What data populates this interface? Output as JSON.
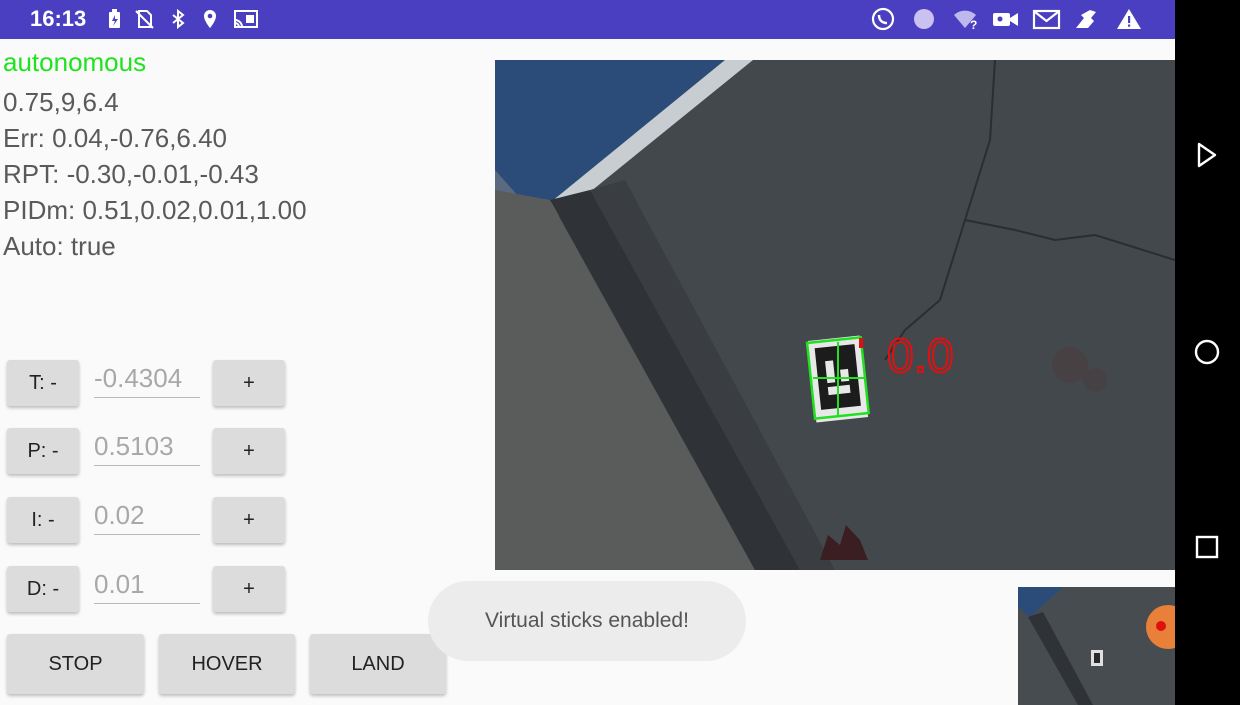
{
  "status_bar": {
    "time": "16:13",
    "left_icons": [
      "battery-icon",
      "no-sim-icon",
      "bluetooth-icon",
      "location-icon",
      "cast-icon"
    ],
    "right_icons": [
      "whatsapp-icon",
      "circle-app-icon",
      "wifi-question-icon",
      "video-camera-icon",
      "gmail-icon",
      "drone-app-icon",
      "warning-icon"
    ]
  },
  "telemetry": {
    "mode": "autonomous",
    "mode_color": "#1ee31e",
    "line1": "0.75,9,6.4",
    "err": "Err: 0.04,-0.76,6.40",
    "rpt": "RPT: -0.30,-0.01,-0.43",
    "pidm": "PIDm: 0.51,0.02,0.01,1.00",
    "auto": "Auto: true"
  },
  "pid_controls": [
    {
      "minus_label": "T: -",
      "value": "-0.4304",
      "plus_label": "+"
    },
    {
      "minus_label": "P: -",
      "value": "0.5103",
      "plus_label": "+"
    },
    {
      "minus_label": "I: -",
      "value": "0.02",
      "plus_label": "+"
    },
    {
      "minus_label": "D: -",
      "value": "0.01",
      "plus_label": "+"
    }
  ],
  "actions": {
    "stop": "STOP",
    "hover": "HOVER",
    "land": "LAND"
  },
  "camera": {
    "overlay_text": "0.0",
    "overlay_color": "#e01010",
    "marker_color": "#20e020"
  },
  "toast": "Virtual sticks enabled!",
  "nav_bar": {
    "back": "back-icon",
    "home": "home-icon",
    "recents": "recents-icon"
  }
}
